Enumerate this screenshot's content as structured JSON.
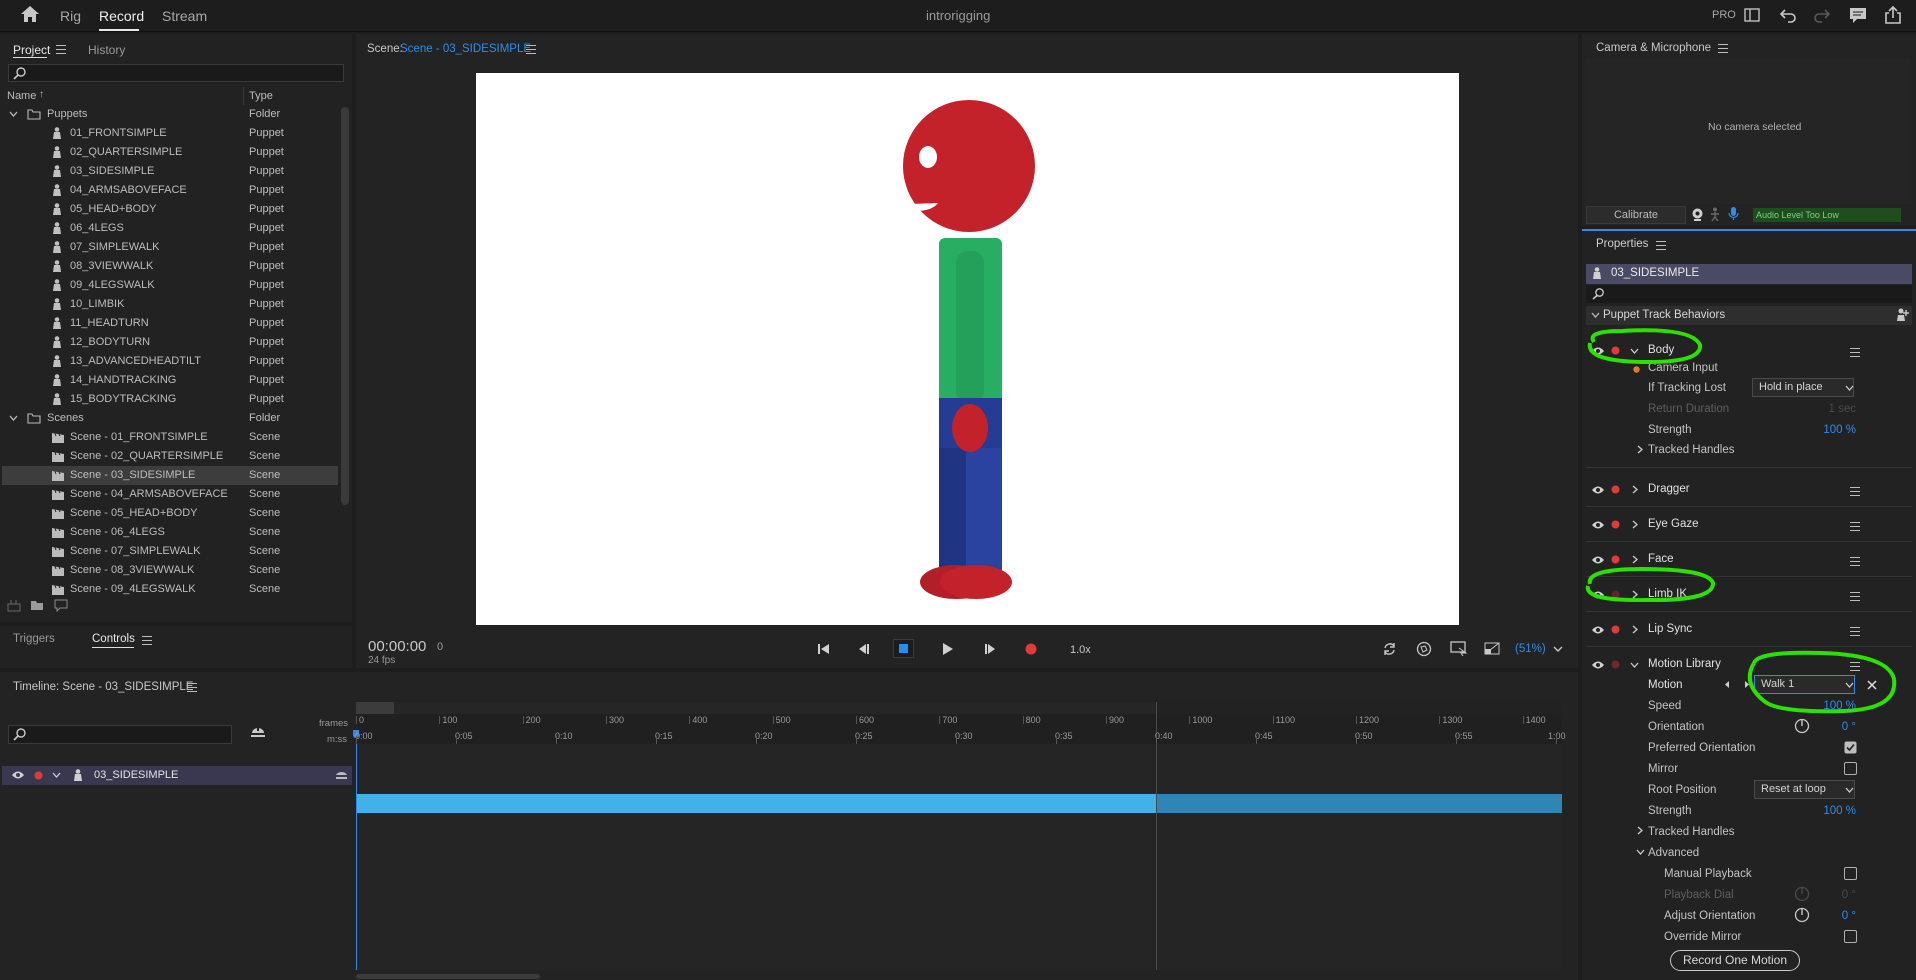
{
  "topbar": {
    "modes": [
      "Rig",
      "Record",
      "Stream"
    ],
    "active_mode": "Record",
    "title": "introrigging",
    "pro": "PRO"
  },
  "project": {
    "tabs": [
      "Project",
      "History"
    ],
    "columns": {
      "name": "Name",
      "sort": "↑",
      "type": "Type"
    },
    "tree": [
      {
        "name": "Puppets",
        "type": "Folder",
        "kind": "folder"
      },
      {
        "name": "01_FRONTSIMPLE",
        "type": "Puppet",
        "kind": "puppet"
      },
      {
        "name": "02_QUARTERSIMPLE",
        "type": "Puppet",
        "kind": "puppet"
      },
      {
        "name": "03_SIDESIMPLE",
        "type": "Puppet",
        "kind": "puppet"
      },
      {
        "name": "04_ARMSABOVEFACE",
        "type": "Puppet",
        "kind": "puppet"
      },
      {
        "name": "05_HEAD+BODY",
        "type": "Puppet",
        "kind": "puppet"
      },
      {
        "name": "06_4LEGS",
        "type": "Puppet",
        "kind": "puppet"
      },
      {
        "name": "07_SIMPLEWALK",
        "type": "Puppet",
        "kind": "puppet"
      },
      {
        "name": "08_3VIEWWALK",
        "type": "Puppet",
        "kind": "puppet"
      },
      {
        "name": "09_4LEGSWALK",
        "type": "Puppet",
        "kind": "puppet"
      },
      {
        "name": "10_LIMBIK",
        "type": "Puppet",
        "kind": "puppet"
      },
      {
        "name": "11_HEADTURN",
        "type": "Puppet",
        "kind": "puppet"
      },
      {
        "name": "12_BODYTURN",
        "type": "Puppet",
        "kind": "puppet"
      },
      {
        "name": "13_ADVANCEDHEADTILT",
        "type": "Puppet",
        "kind": "puppet"
      },
      {
        "name": "14_HANDTRACKING",
        "type": "Puppet",
        "kind": "puppet"
      },
      {
        "name": "15_BODYTRACKING",
        "type": "Puppet",
        "kind": "puppet"
      },
      {
        "name": "Scenes",
        "type": "Folder",
        "kind": "folder"
      },
      {
        "name": "Scene - 01_FRONTSIMPLE",
        "type": "Scene",
        "kind": "scene"
      },
      {
        "name": "Scene - 02_QUARTERSIMPLE",
        "type": "Scene",
        "kind": "scene"
      },
      {
        "name": "Scene - 03_SIDESIMPLE",
        "type": "Scene",
        "kind": "scene",
        "selected": true
      },
      {
        "name": "Scene - 04_ARMSABOVEFACE",
        "type": "Scene",
        "kind": "scene"
      },
      {
        "name": "Scene - 05_HEAD+BODY",
        "type": "Scene",
        "kind": "scene"
      },
      {
        "name": "Scene - 06_4LEGS",
        "type": "Scene",
        "kind": "scene"
      },
      {
        "name": "Scene - 07_SIMPLEWALK",
        "type": "Scene",
        "kind": "scene"
      },
      {
        "name": "Scene - 08_3VIEWWALK",
        "type": "Scene",
        "kind": "scene"
      },
      {
        "name": "Scene - 09_4LEGSWALK",
        "type": "Scene",
        "kind": "scene"
      }
    ]
  },
  "controls": {
    "tabs": [
      "Triggers",
      "Controls"
    ],
    "active": "Controls"
  },
  "scene": {
    "label": "Scene:",
    "name": "Scene - 03_SIDESIMPLE",
    "timecode": "00:00:00",
    "frame": "0",
    "fps": "24 fps",
    "speed": "1.0x",
    "zoom": "(51%)"
  },
  "camera": {
    "title": "Camera & Microphone",
    "empty": "No camera selected",
    "calibrate": "Calibrate",
    "audio_status": "Audio Level Too Low"
  },
  "properties": {
    "title": "Properties",
    "puppet": "03_SIDESIMPLE",
    "section": "Puppet Track Behaviors",
    "body": {
      "name": "Body",
      "camera_input": "Camera Input",
      "if_tracking_lost_label": "If Tracking Lost",
      "if_tracking_lost_value": "Hold in place",
      "return_duration_label": "Return Duration",
      "return_duration_value": "1 sec",
      "strength_label": "Strength",
      "strength_value": "100 %",
      "tracked_handles": "Tracked Handles"
    },
    "behaviors": [
      "Dragger",
      "Eye Gaze",
      "Face",
      "Limb IK",
      "Lip Sync"
    ],
    "motion_library": {
      "name": "Motion Library",
      "motion_label": "Motion",
      "motion_value": "Walk 1",
      "speed_label": "Speed",
      "speed_value": "100 %",
      "orientation_label": "Orientation",
      "orientation_value": "0 °",
      "preferred_orientation": "Preferred Orientation",
      "mirror": "Mirror",
      "root_position_label": "Root Position",
      "root_position_value": "Reset at loop",
      "strength_label": "Strength",
      "strength_value": "100 %",
      "tracked_handles": "Tracked Handles",
      "advanced": "Advanced",
      "manual_playback": "Manual Playback",
      "playback_dial_label": "Playback Dial",
      "playback_dial_value": "0 °",
      "adjust_orientation_label": "Adjust Orientation",
      "adjust_orientation_value": "0 °",
      "override_mirror": "Override Mirror",
      "record_button": "Record One Motion"
    }
  },
  "timeline": {
    "title": "Timeline: Scene - 03_SIDESIMPLE",
    "frames_label": "frames",
    "time_label": "m:ss",
    "frame_ticks": [
      "0",
      "100",
      "200",
      "300",
      "400",
      "500",
      "600",
      "700",
      "800",
      "900",
      "1000",
      "1100",
      "1200",
      "1300",
      "1400"
    ],
    "time_ticks": [
      "0:00",
      "0:05",
      "0:10",
      "0:15",
      "0:20",
      "0:25",
      "0:30",
      "0:35",
      "0:40",
      "0:45",
      "0:50",
      "0:55",
      "1:00"
    ],
    "track_name": "03_SIDESIMPLE"
  },
  "colors": {
    "accent": "#2d8ceb",
    "highlight": "#2ce000",
    "record": "#e03a3a",
    "track": "#41b1e7",
    "puppet_head": "#c3222b",
    "puppet_shirt": "#27ae62",
    "puppet_pants": "#243c94"
  }
}
